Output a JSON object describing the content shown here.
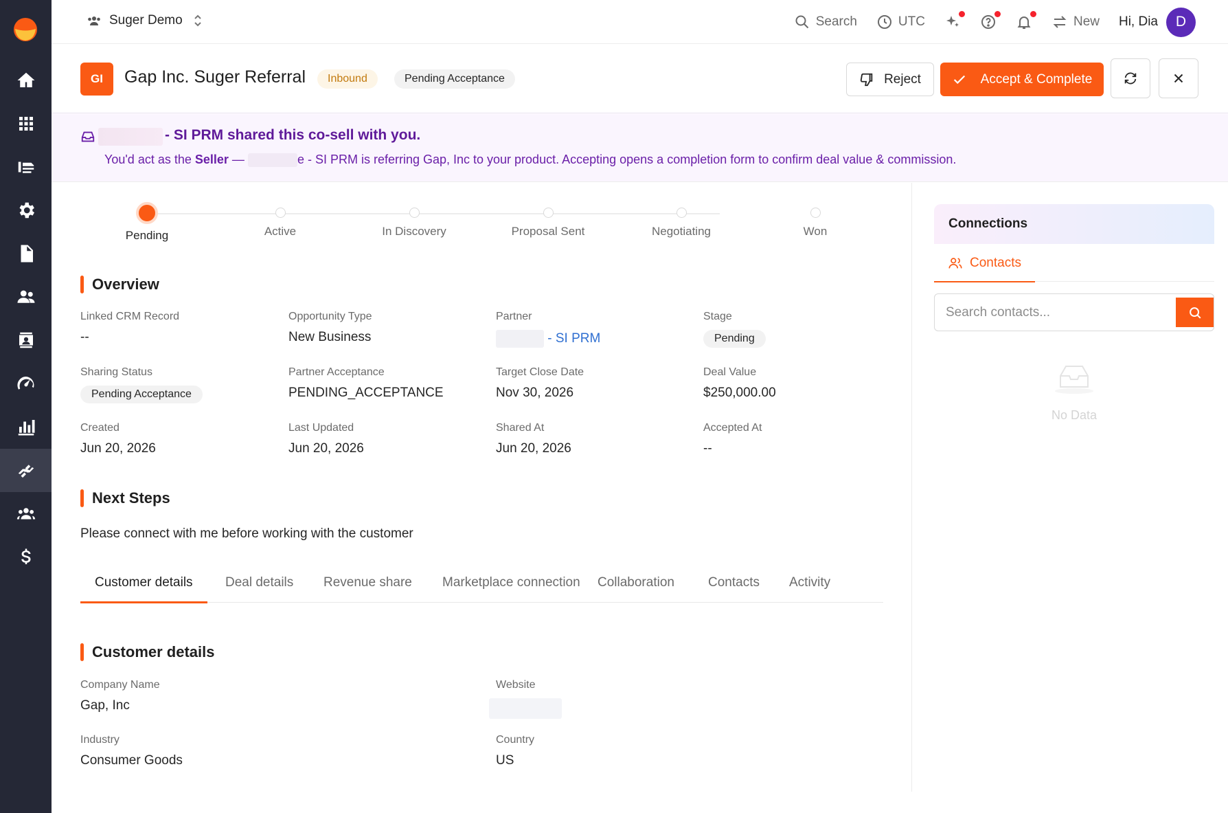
{
  "topbar": {
    "workspace": "Suger Demo",
    "search": "Search",
    "timezone": "UTC",
    "new": "New",
    "greeting": "Hi, Dia",
    "avatar_initial": "D"
  },
  "header": {
    "badge": "GI",
    "title": "Gap Inc. Suger Referral",
    "tag_inbound": "Inbound",
    "tag_status": "Pending Acceptance",
    "reject_label": "Reject",
    "accept_label": "Accept & Complete"
  },
  "banner": {
    "title": "- SI PRM shared this co-sell with you.",
    "line_prefix": "You'd act as the ",
    "line_role": "Seller",
    "line_dash": " — ",
    "line_rest": "e - SI PRM is referring Gap, Inc to your product. Accepting opens a completion form to confirm deal value & commission."
  },
  "stages": [
    "Pending",
    "Active",
    "In Discovery",
    "Proposal Sent",
    "Negotiating",
    "Won"
  ],
  "overview": {
    "heading": "Overview",
    "fields": [
      {
        "label": "Linked CRM Record",
        "value": "--"
      },
      {
        "label": "Opportunity Type",
        "value": "New Business"
      },
      {
        "label": "Partner",
        "value": "- SI PRM"
      },
      {
        "label": "Stage",
        "value": "Pending"
      },
      {
        "label": "Sharing Status",
        "value": "Pending Acceptance"
      },
      {
        "label": "Partner Acceptance",
        "value": "PENDING_ACCEPTANCE"
      },
      {
        "label": "Target Close Date",
        "value": "Nov 30, 2026"
      },
      {
        "label": "Deal Value",
        "value": "$250,000.00"
      },
      {
        "label": "Created",
        "value": "Jun 20, 2026"
      },
      {
        "label": "Last Updated",
        "value": "Jun 20, 2026"
      },
      {
        "label": "Shared At",
        "value": "Jun 20, 2026"
      },
      {
        "label": "Accepted At",
        "value": "--"
      }
    ]
  },
  "next_steps": {
    "heading": "Next Steps",
    "text": "Please connect with me before working with the customer"
  },
  "tabs": [
    "Customer details",
    "Deal details",
    "Revenue share",
    "Marketplace connection",
    "Collaboration",
    "Contacts",
    "Activity"
  ],
  "customer": {
    "heading": "Customer details",
    "company_label": "Company Name",
    "company_value": "Gap, Inc",
    "website_label": "Website",
    "industry_label": "Industry",
    "industry_value": "Consumer Goods",
    "country_label": "Country",
    "country_value": "US"
  },
  "connections": {
    "heading": "Connections",
    "tab_contacts": "Contacts",
    "search_placeholder": "Search contacts...",
    "empty": "No Data"
  },
  "colors": {
    "accent": "#fa5a14",
    "sidebar": "#252836",
    "banner_text": "#6a1fa8",
    "link": "#2f6fd1"
  }
}
